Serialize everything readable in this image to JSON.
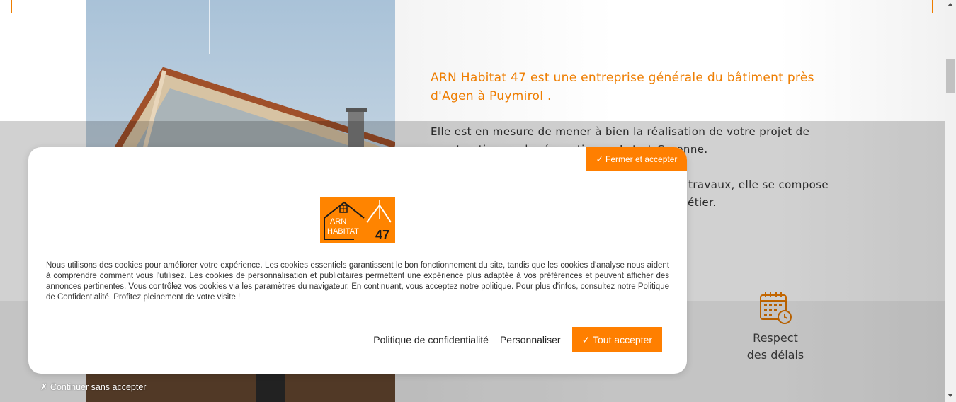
{
  "page": {
    "intro": "ARN Habitat 47 est une entreprise générale du bâtiment près d'Agen à Puymirol .",
    "paragraph1": "Elle est en mesure de mener à bien la réalisation de votre projet de construction ou de rénovation en Lot-et-Garonne.",
    "paragraph2": "Forte de son expérience dans le domaine des travaux, elle se compose d'une équipe de professionnels qualifiés de métier.",
    "feature": {
      "label_line1": "Respect",
      "label_line2": "des délais",
      "icon": "calendar-clock-icon"
    }
  },
  "cookie_banner": {
    "close_accept_label": "✓ Fermer et accepter",
    "logo_text_line1": "ARN",
    "logo_text_line2": "HABITAT",
    "logo_number": "47",
    "message": "Nous utilisons des cookies pour améliorer votre expérience. Les cookies essentiels garantissent le bon fonctionnement du site, tandis que les cookies d'analyse nous aident à comprendre comment vous l'utilisez. Les cookies de personnalisation et publicitaires permettent une expérience plus adaptée à vos préférences et peuvent afficher des annonces pertinentes. Vous contrôlez vos cookies via les paramètres du navigateur. En continuant, vous acceptez notre politique. Pour plus d'infos, consultez notre Politique de Confidentialité. Profitez pleinement de votre visite !",
    "privacy_link": "Politique de confidentialité",
    "customize_link": "Personnaliser",
    "accept_all_label": "✓ Tout accepter",
    "continue_label": "✗ Continuer sans accepter"
  },
  "colors": {
    "accent": "#ff7f00",
    "text": "#333333"
  }
}
